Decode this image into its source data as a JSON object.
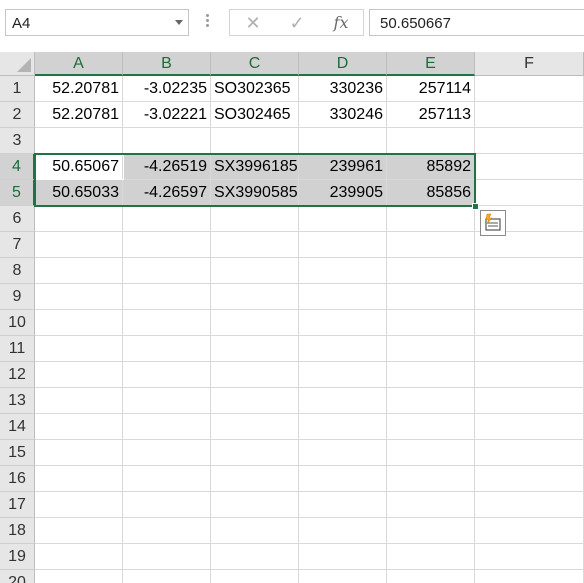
{
  "formula_bar": {
    "name_box": "A4",
    "cancel_glyph": "✕",
    "enter_glyph": "✓",
    "fx_label": "fx",
    "value": "50.650667"
  },
  "columns": [
    "A",
    "B",
    "C",
    "D",
    "E",
    "F"
  ],
  "active_columns": [
    "A",
    "B",
    "C",
    "D",
    "E"
  ],
  "rows": [
    "1",
    "2",
    "3",
    "4",
    "5",
    "6",
    "7",
    "8",
    "9",
    "10",
    "11",
    "12",
    "13",
    "14",
    "15",
    "16",
    "17",
    "18",
    "19",
    "20"
  ],
  "active_rows": [
    "4",
    "5"
  ],
  "cells": [
    [
      "52.20781",
      "-3.02235",
      "SO302365",
      "330236",
      "257114",
      ""
    ],
    [
      "52.20781",
      "-3.02221",
      "SO302465",
      "330246",
      "257113",
      ""
    ],
    [
      "",
      "",
      "",
      "",
      "",
      ""
    ],
    [
      "50.65067",
      "-4.26519",
      "SX3996185",
      "239961",
      "85892",
      ""
    ],
    [
      "50.65033",
      "-4.26597",
      "SX3990585",
      "239905",
      "85856",
      ""
    ]
  ],
  "icons": {
    "quick_analysis": "quick-analysis-icon"
  },
  "colors": {
    "selection_border": "#217346",
    "selection_fill": "#d1d1d1",
    "header_bg": "#e6e6e6"
  }
}
